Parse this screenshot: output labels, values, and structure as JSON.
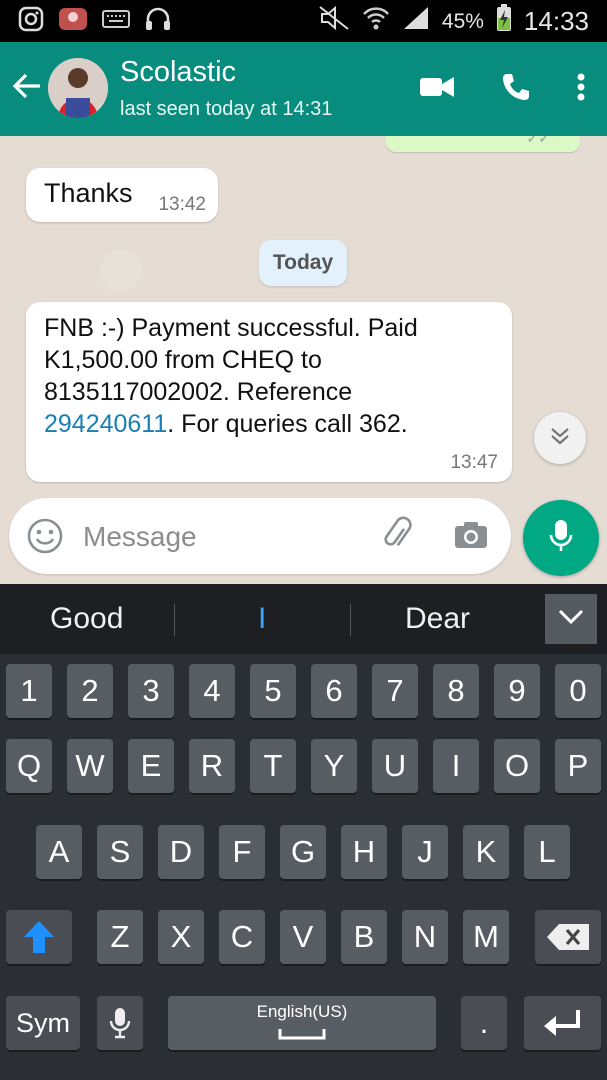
{
  "statusbar": {
    "battery_pct": "45%",
    "time": "14:33"
  },
  "header": {
    "name": "Scolastic",
    "last_seen": "last seen today at 14:31"
  },
  "messages": {
    "thanks": {
      "text": "Thanks",
      "time": "13:42"
    },
    "date_divider": "Today",
    "fnb": {
      "part1": "FNB :-) Payment successful. Paid K1,500.00 from CHEQ to 8135117002002. Reference ",
      "reference": "294240611",
      "part2": ". For queries call 362.",
      "time": "13:47"
    }
  },
  "composer": {
    "placeholder": "Message"
  },
  "keyboard": {
    "suggestions": [
      "Good",
      "I",
      "Dear"
    ],
    "row_numbers": [
      "1",
      "2",
      "3",
      "4",
      "5",
      "6",
      "7",
      "8",
      "9",
      "0"
    ],
    "row1": [
      "Q",
      "W",
      "E",
      "R",
      "T",
      "Y",
      "U",
      "I",
      "O",
      "P"
    ],
    "row2": [
      "A",
      "S",
      "D",
      "F",
      "G",
      "H",
      "J",
      "K",
      "L"
    ],
    "row3": [
      "Z",
      "X",
      "C",
      "V",
      "B",
      "N",
      "M"
    ],
    "sym_label": "Sym",
    "space_label": "English(US)",
    "period": "."
  },
  "colors": {
    "header": "#078c7e",
    "accent": "#00a884",
    "link": "#1a7fb5",
    "shift": "#1e90ff"
  }
}
